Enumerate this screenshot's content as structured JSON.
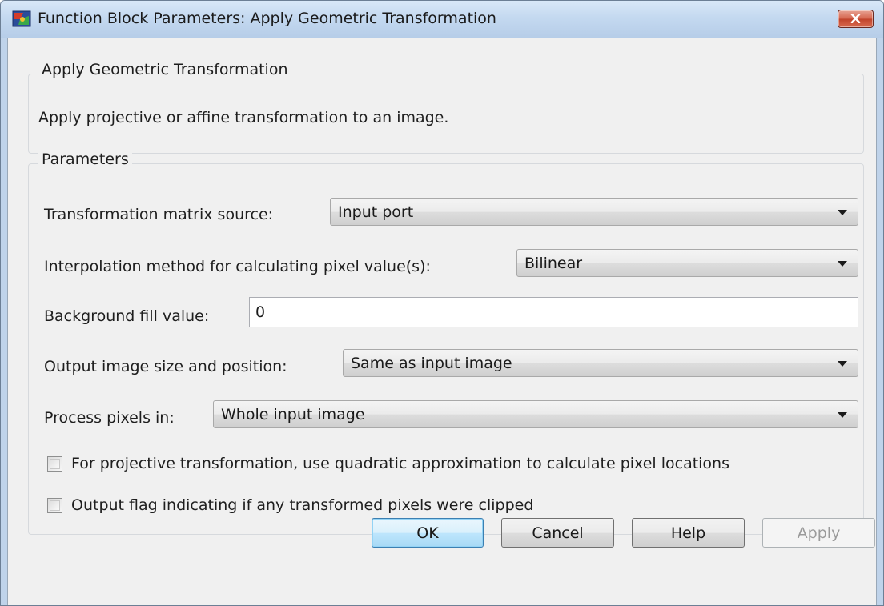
{
  "window": {
    "title": "Function Block Parameters: Apply Geometric Transformation",
    "icon": "simulink-block-icon",
    "close_icon": "close-icon"
  },
  "description_group": {
    "title": "Apply Geometric Transformation",
    "text": "Apply projective or affine transformation to an image."
  },
  "parameters_group": {
    "title": "Parameters",
    "fields": {
      "matrix_source": {
        "label": "Transformation matrix source:",
        "value": "Input port"
      },
      "interpolation": {
        "label": "Interpolation method for calculating pixel value(s):",
        "value": "Bilinear"
      },
      "background_fill": {
        "label": "Background fill value:",
        "value": "0"
      },
      "output_size": {
        "label": "Output image size and position:",
        "value": "Same as input image"
      },
      "process_pixels": {
        "label": "Process pixels in:",
        "value": "Whole input image"
      }
    },
    "checkboxes": {
      "quadratic": {
        "label": "For projective transformation, use quadratic approximation to calculate pixel locations",
        "checked": false
      },
      "clip_flag": {
        "label": "Output flag indicating if any transformed pixels were clipped",
        "checked": false
      }
    }
  },
  "buttons": {
    "ok": "OK",
    "cancel": "Cancel",
    "help": "Help",
    "apply": "Apply"
  },
  "colors": {
    "titlebar": "#c4d9f0",
    "client_bg": "#f0f0f0",
    "close_button": "#c7432b",
    "default_button": "#bee6fd"
  }
}
